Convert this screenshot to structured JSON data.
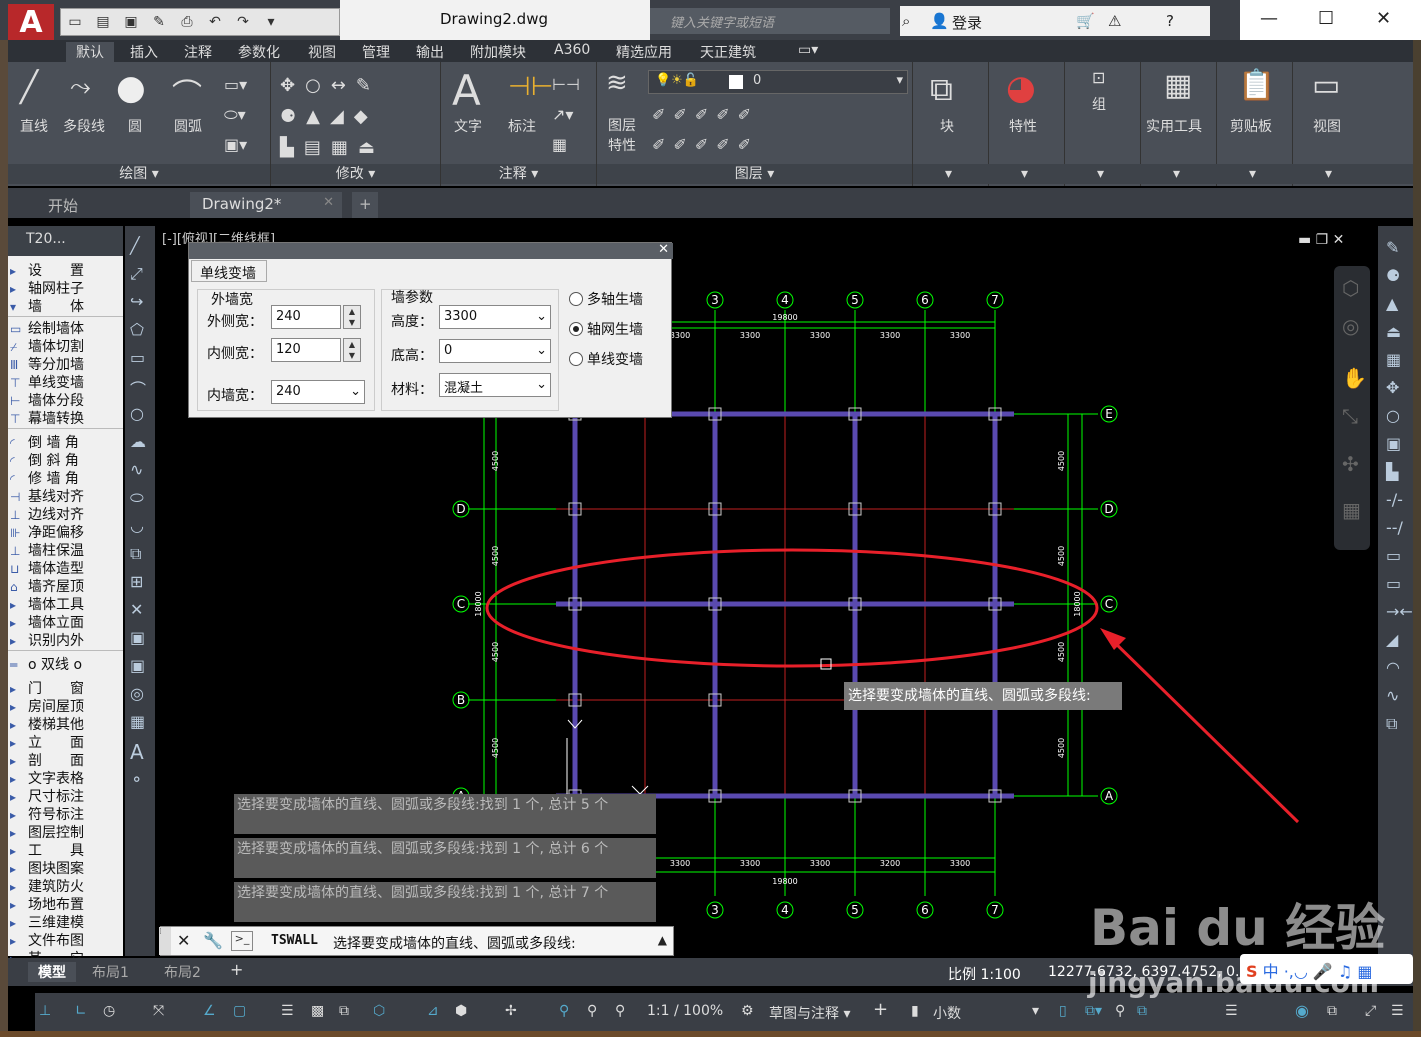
{
  "app": {
    "logo": "A",
    "doc_title": "Drawing2.dwg",
    "search_placeholder": "键入关键字或短语",
    "login": "登录"
  },
  "qat_icons": [
    "new-icon",
    "open-icon",
    "save-icon",
    "saveas-icon",
    "print-icon",
    "undo-icon",
    "redo-icon",
    "dropdown-icon"
  ],
  "menu": [
    "默认",
    "插入",
    "注释",
    "参数化",
    "视图",
    "管理",
    "输出",
    "附加模块",
    "A360",
    "精选应用",
    "天正建筑"
  ],
  "ribbon": {
    "draw_buttons": [
      "直线",
      "多段线",
      "圆",
      "圆弧"
    ],
    "panels": [
      "绘图",
      "修改",
      "注释",
      "图层"
    ],
    "annot_buttons": [
      "文字",
      "标注"
    ],
    "layer_button": [
      "图层",
      "特性"
    ],
    "layer_value": "0",
    "big_buttons": [
      "块",
      "特性",
      "组",
      "实用工具",
      "剪贴板",
      "视图"
    ]
  },
  "doctabs": [
    "开始",
    "Drawing2*"
  ],
  "viewport_label": "[-][俯视][二维线框]",
  "tpanel": {
    "title": "T20...",
    "items": [
      "设　　置",
      "轴网柱子",
      "墙　　体",
      "绘制墙体",
      "墙体切割",
      "等分加墙",
      "单线变墙",
      "墙体分段",
      "幕墙转换",
      "倒 墙 角",
      "倒 斜 角",
      "修 墙 角",
      "基线对齐",
      "边线对齐",
      "净距偏移",
      "墙柱保温",
      "墙体造型",
      "墙齐屋顶",
      "墙体工具",
      "墙体立面",
      "识别内外",
      "o 双线 o",
      "门　　窗",
      "房间屋顶",
      "楼梯其他",
      "立　　面",
      "剖　　面",
      "文字表格",
      "尺寸标注",
      "符号标注",
      "图层控制",
      "工　　具",
      "图块图案",
      "建筑防火",
      "场地布置",
      "三维建模",
      "文件布图",
      "其　　它"
    ]
  },
  "dialog": {
    "tab": "单线变墙",
    "outer_group": "外墙宽",
    "outer_side_label": "外侧宽：",
    "outer_side_value": "240",
    "inner_side_label": "内侧宽：",
    "inner_side_value": "120",
    "inner_wall_label": "内墙宽：",
    "inner_wall_value": "240",
    "wall_group": "墙参数",
    "height_label": "高度：",
    "height_value": "3300",
    "base_label": "底高：",
    "base_value": "0",
    "material_label": "材料：",
    "material_value": "混凝土",
    "radios": [
      {
        "label": "多轴生墙",
        "checked": false
      },
      {
        "label": "轴网生墙",
        "checked": true
      },
      {
        "label": "单线变墙",
        "checked": false
      }
    ]
  },
  "drawing": {
    "axis_top": [
      "3",
      "4",
      "5",
      "6",
      "7"
    ],
    "axis_side": [
      "E",
      "D",
      "C",
      "B",
      "A"
    ],
    "dims_x": [
      "3300",
      "3300",
      "3300",
      "3300",
      "3300"
    ],
    "dims_x_bottom": [
      "3300",
      "3300",
      "3300",
      "3200",
      "3300"
    ],
    "total_x": "19800",
    "dims_y": [
      "4500",
      "4500",
      "4500",
      "4500"
    ],
    "total_y": "18000",
    "tooltip": "选择要变成墙体的直线、圆弧或多段线:",
    "small_label": "3300"
  },
  "command_history": [
    "选择要变成墙体的直线、圆弧或多段线:找到 1 个, 总计 5 个",
    "选择要变成墙体的直线、圆弧或多段线:找到 1 个, 总计 6 个",
    "选择要变成墙体的直线、圆弧或多段线:找到 1 个, 总计 7 个"
  ],
  "command_line": {
    "cmd": "TSWALL",
    "prompt": "选择要变成墙体的直线、圆弧或多段线:"
  },
  "layout_tabs": [
    "模型",
    "布局1",
    "布局2"
  ],
  "status": {
    "scale": "比例 1:100",
    "coords": "12277.6732, 6397.4752, 0.0000",
    "zoom": "1:1 / 100%",
    "workspace": "草图与注释",
    "units": "小数"
  },
  "watermark": {
    "brand": "Bai du 经验",
    "url": "jingyan.baidu.com"
  },
  "colors": {
    "accent_red": "#e8202a",
    "axis_green": "#00ff00",
    "wall_purple": "#5a4ab0",
    "grid_red": "#c02020"
  }
}
